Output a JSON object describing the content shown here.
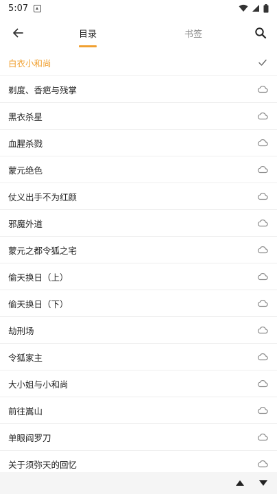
{
  "status_bar": {
    "time": "5:07",
    "icons": [
      "notification-icon",
      "wifi-icon",
      "signal-icon",
      "battery-icon"
    ]
  },
  "header": {
    "back_icon": "arrow-left-icon",
    "tabs": [
      {
        "label": "目录",
        "selected": true
      },
      {
        "label": "书签",
        "selected": false
      }
    ],
    "search_icon": "search-icon",
    "accent_color": "#f0a030"
  },
  "chapters": [
    {
      "title": "白衣小和尚",
      "status": "current"
    },
    {
      "title": "剃度、香疤与残掌",
      "status": "cloud"
    },
    {
      "title": "黑衣杀星",
      "status": "cloud"
    },
    {
      "title": "血腥杀戮",
      "status": "cloud"
    },
    {
      "title": "蒙元绝色",
      "status": "cloud"
    },
    {
      "title": "仗义出手不为红颜",
      "status": "cloud"
    },
    {
      "title": "邪魔外道",
      "status": "cloud"
    },
    {
      "title": "蒙元之都令狐之宅",
      "status": "cloud"
    },
    {
      "title": "偷天换日（上）",
      "status": "cloud"
    },
    {
      "title": "偷天换日（下）",
      "status": "cloud"
    },
    {
      "title": "劫刑场",
      "status": "cloud"
    },
    {
      "title": "令狐家主",
      "status": "cloud"
    },
    {
      "title": "大小姐与小和尚",
      "status": "cloud"
    },
    {
      "title": "前往嵩山",
      "status": "cloud"
    },
    {
      "title": "单眼阎罗刀",
      "status": "cloud"
    },
    {
      "title": "关于须弥天的回忆",
      "status": "cloud"
    }
  ],
  "bottom_bar": {
    "icons": [
      "triangle-up-icon",
      "triangle-down-icon"
    ]
  }
}
